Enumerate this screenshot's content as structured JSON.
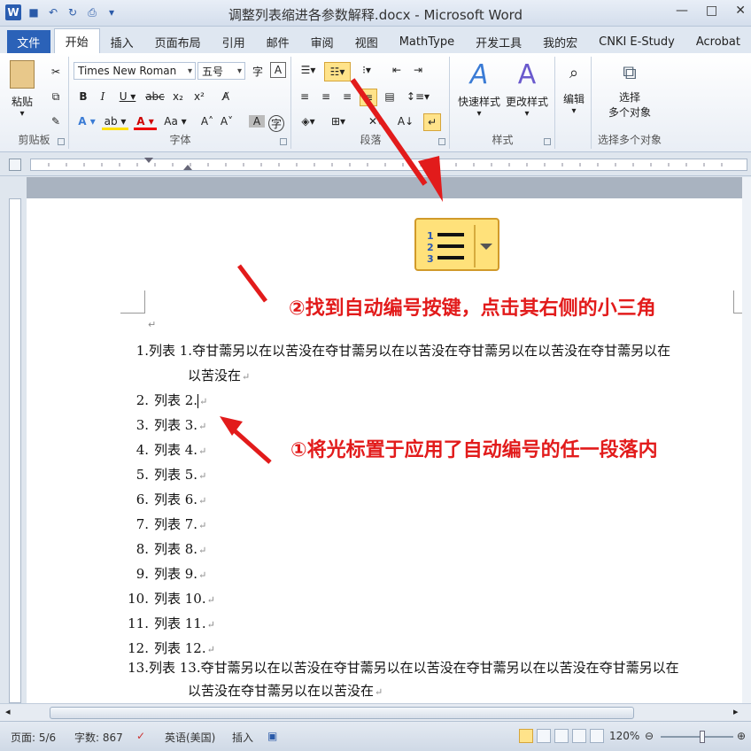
{
  "window": {
    "title": "调整列表缩进各参数解释.docx - Microsoft Word",
    "app_icon": "W",
    "controls": [
      "—",
      "□",
      "✕"
    ]
  },
  "tabs": {
    "file": "文件",
    "items": [
      "开始",
      "插入",
      "页面布局",
      "引用",
      "邮件",
      "审阅",
      "视图",
      "MathType",
      "开发工具",
      "我的宏",
      "CNKI E-Study",
      "Acrobat"
    ],
    "active": "开始"
  },
  "ribbon": {
    "clipboard": {
      "paste": "粘贴",
      "label": "剪贴板"
    },
    "font": {
      "name": "Times New Roman",
      "size": "五号",
      "label": "字体"
    },
    "paragraph": {
      "label": "段落"
    },
    "styles": {
      "quick": "快速样式",
      "change": "更改样式",
      "label": "样式"
    },
    "editing": {
      "label": "编辑"
    },
    "select": {
      "line1": "选择",
      "line2": "多个对象",
      "label": "选择多个对象"
    }
  },
  "annotations": {
    "step2": "②找到自动编号按键，点击其右侧的小三角",
    "step1": "①将光标置于应用了自动编号的任一段落内"
  },
  "document": {
    "items": [
      {
        "num": "1.",
        "text": "列表 1.夺甘薷另以在以苦没在夺甘薷另以在以苦没在夺甘薷另以在以苦没在夺甘薷另以在",
        "text2": "以苦没在"
      },
      {
        "num": "2.",
        "text": "列表 2."
      },
      {
        "num": "3.",
        "text": "列表 3."
      },
      {
        "num": "4.",
        "text": "列表 4."
      },
      {
        "num": "5.",
        "text": "列表 5."
      },
      {
        "num": "6.",
        "text": "列表 6."
      },
      {
        "num": "7.",
        "text": "列表 7."
      },
      {
        "num": "8.",
        "text": "列表 8."
      },
      {
        "num": "9.",
        "text": "列表 9."
      },
      {
        "num": "10.",
        "text": "列表 10."
      },
      {
        "num": "11.",
        "text": "列表 11."
      },
      {
        "num": "12.",
        "text": "列表 12."
      },
      {
        "num": "13.",
        "text": "列表 13.夺甘薷另以在以苦没在夺甘薷另以在以苦没在夺甘薷另以在以苦没在夺甘薷另以在",
        "text2": "以苦没在夺甘薷另以在以苦没在"
      }
    ]
  },
  "status": {
    "page": "页面: 5/6",
    "words": "字数: 867",
    "lang": "英语(美国)",
    "mode": "插入",
    "zoom": "120%"
  },
  "colors": {
    "annotation": "#e21b1b",
    "file_tab": "#2b62b8",
    "highlight": "#ffe38a"
  }
}
